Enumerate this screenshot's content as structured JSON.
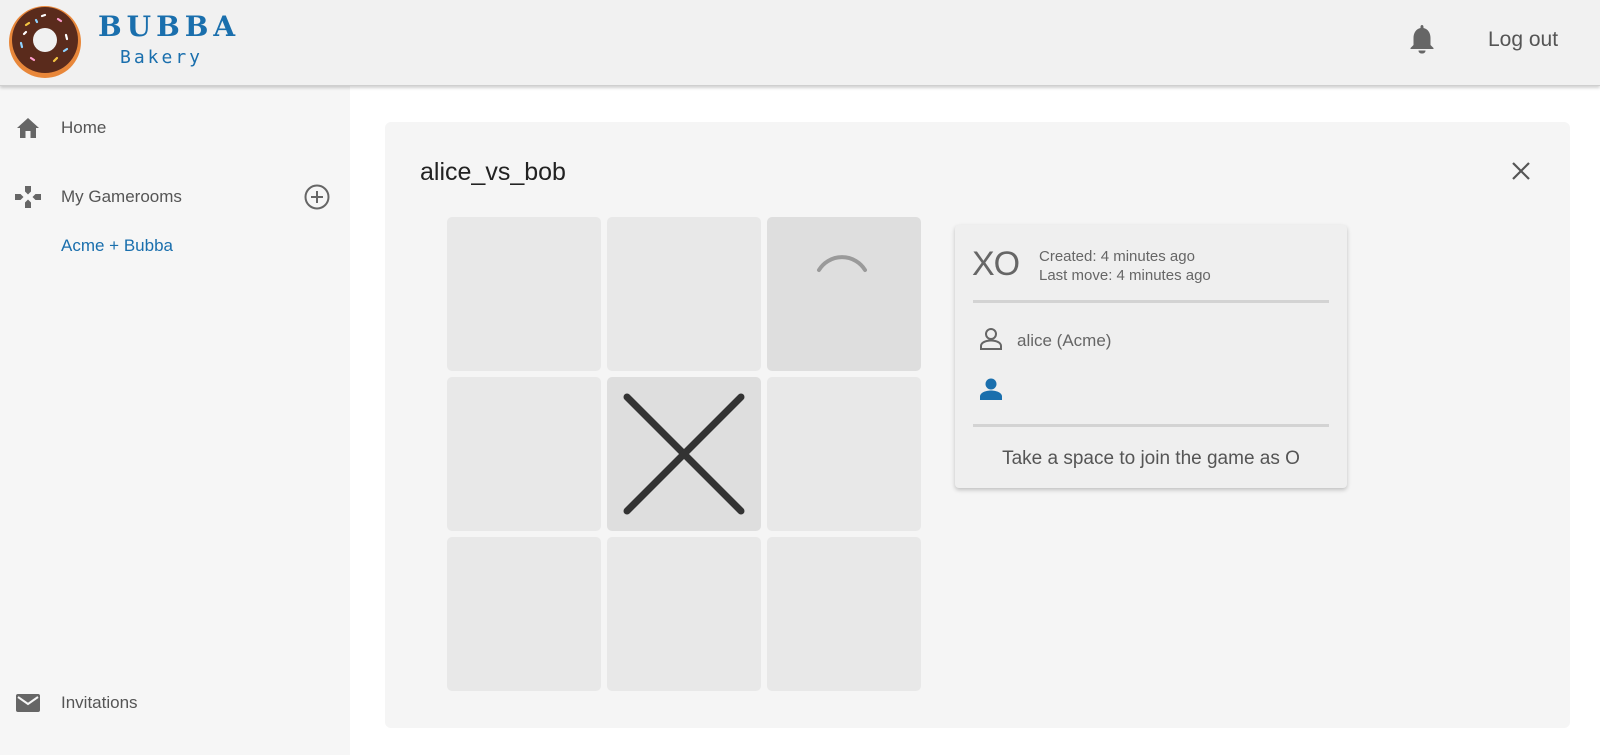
{
  "header": {
    "brand_name": "BUBBA",
    "brand_sub": "Bakery",
    "logout_label": "Log out",
    "icons": [
      "donut-logo",
      "bell-icon"
    ]
  },
  "sidebar": {
    "items": [
      {
        "label": "Home",
        "icon": "home-icon"
      },
      {
        "label": "My Gamerooms",
        "icon": "gamepad-icon",
        "action_icon": "add-circle-icon"
      },
      {
        "label": "Invitations",
        "icon": "mail-icon"
      }
    ],
    "gamerooms": [
      {
        "label": "Acme + Bubba"
      }
    ]
  },
  "game": {
    "title": "alice_vs_bob",
    "board": [
      "",
      "",
      "O-loading",
      "",
      "X",
      "",
      "",
      "",
      ""
    ],
    "info": {
      "mark_label": "XO",
      "created": "Created: 4 minutes ago",
      "last_move": "Last move: 4 minutes ago",
      "player_x": "alice (Acme)",
      "player_o": "",
      "join_message": "Take a space to join the game as O"
    }
  },
  "colors": {
    "accent": "#1a6fad",
    "header_bg": "#f1f1f1",
    "sidebar_bg": "#f6f6f6",
    "card_bg": "#f5f5f5",
    "cell_bg": "#e8e8e8",
    "mark_color": "#333333"
  }
}
